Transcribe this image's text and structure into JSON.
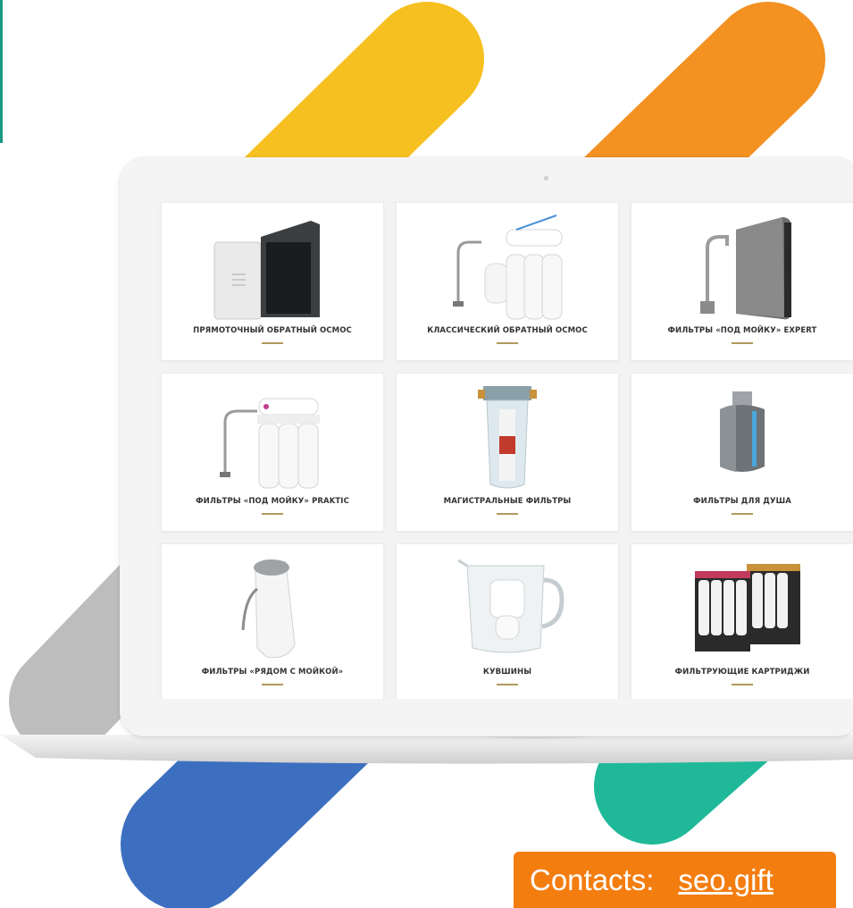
{
  "colors": {
    "yellow": "#f6c020",
    "orange": "#f39121",
    "gray": "#bdbdbd",
    "blue": "#3d6fc0",
    "green": "#1fb99a",
    "gold_underline": "#b09a5c",
    "contact_bg": "#f47d10"
  },
  "products": [
    {
      "label": "ПРЯМОТОЧНЫЙ ОБРАТНЫЙ ОСМОС",
      "icon": "reverse-osmosis-cabinet-icon"
    },
    {
      "label": "КЛАССИЧЕСКИЙ ОБРАТНЫЙ ОСМОС",
      "icon": "classic-reverse-osmosis-icon"
    },
    {
      "label": "ФИЛЬТРЫ «ПОД МОЙКУ» EXPERT",
      "icon": "under-sink-expert-icon"
    },
    {
      "label": "ФИЛЬТРЫ «ПОД МОЙКУ» PRAKTIC",
      "icon": "under-sink-praktic-icon"
    },
    {
      "label": "МАГИСТРАЛЬНЫЕ ФИЛЬТРЫ",
      "icon": "mainline-filter-icon"
    },
    {
      "label": "ФИЛЬТРЫ ДЛЯ ДУША",
      "icon": "shower-filter-icon"
    },
    {
      "label": "ФИЛЬТРЫ «РЯДОМ С МОЙКОЙ»",
      "icon": "countertop-filter-icon"
    },
    {
      "label": "КУВШИНЫ",
      "icon": "pitcher-icon"
    },
    {
      "label": "ФИЛЬТРУЮЩИЕ КАРТРИДЖИ",
      "icon": "cartridges-icon"
    }
  ],
  "contacts": {
    "label": "Contacts:",
    "link": "seo.gift"
  }
}
